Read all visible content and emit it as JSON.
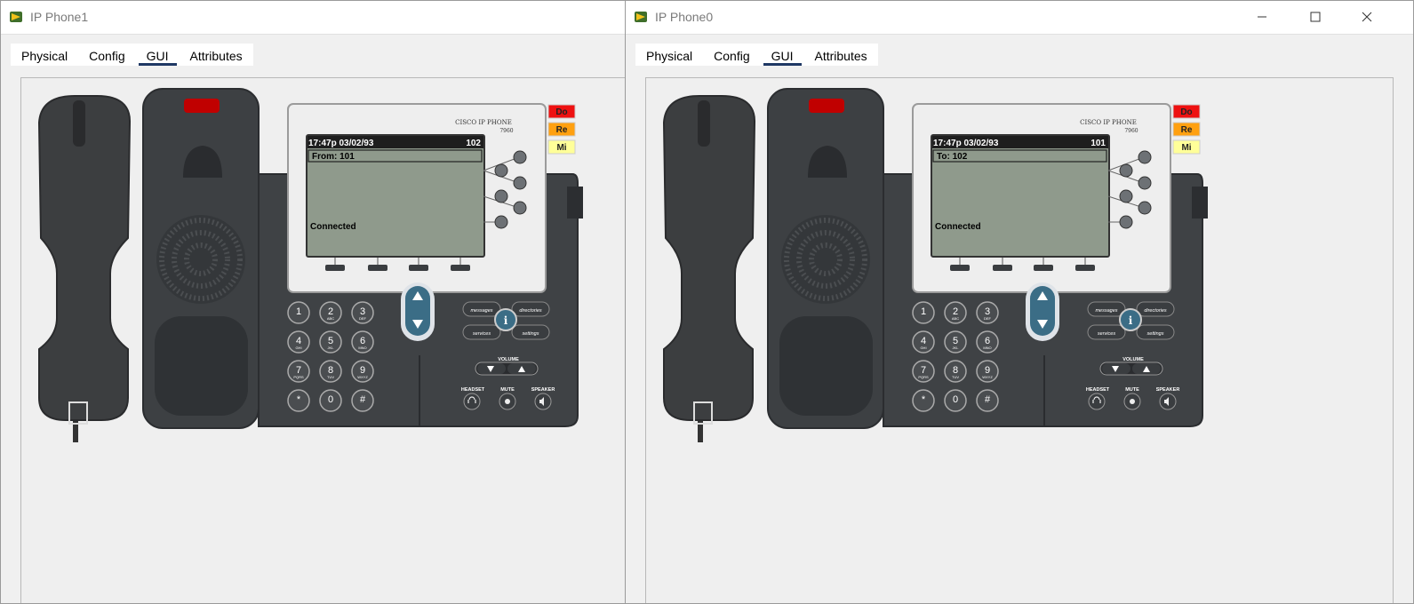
{
  "windows": [
    {
      "title": "IP Phone1",
      "tabs": [
        "Physical",
        "Config",
        "GUI",
        "Attributes"
      ],
      "active_tab": "GUI",
      "phone": {
        "brand": "CISCO IP PHONE",
        "model": "7960",
        "datetime": "17:47p 03/02/93",
        "extension": "102",
        "call_line": "From: 101",
        "status": "Connected"
      },
      "side_buttons": [
        "Do",
        "Re",
        "Mi"
      ]
    },
    {
      "title": "IP Phone0",
      "tabs": [
        "Physical",
        "Config",
        "GUI",
        "Attributes"
      ],
      "active_tab": "GUI",
      "phone": {
        "brand": "CISCO IP PHONE",
        "model": "7960",
        "datetime": "17:47p 03/02/93",
        "extension": "101",
        "call_line": "To: 102",
        "status": "Connected"
      },
      "side_buttons": [
        "Do",
        "Re",
        "Mi"
      ]
    }
  ],
  "keypad": {
    "digits": [
      "1",
      "2",
      "3",
      "4",
      "5",
      "6",
      "7",
      "8",
      "9",
      "*",
      "0",
      "#"
    ],
    "letters": [
      "",
      "ABC",
      "DEF",
      "GHI",
      "JKL",
      "MNO",
      "PQRS",
      "TUV",
      "WXYZ",
      "",
      "",
      ""
    ]
  },
  "function_keys": [
    "messages",
    "directories",
    "services",
    "settings"
  ],
  "volume_label": "VOLUME",
  "audio_keys": [
    "HEADSET",
    "MUTE",
    "SPEAKER"
  ],
  "colors": {
    "do_button": "#ee1111",
    "re_button": "#ffa010",
    "mi_button": "#ffff99",
    "screen": "#8f9a8c",
    "phone_body": "#3f4245",
    "tab_underline": "#1f3864"
  }
}
